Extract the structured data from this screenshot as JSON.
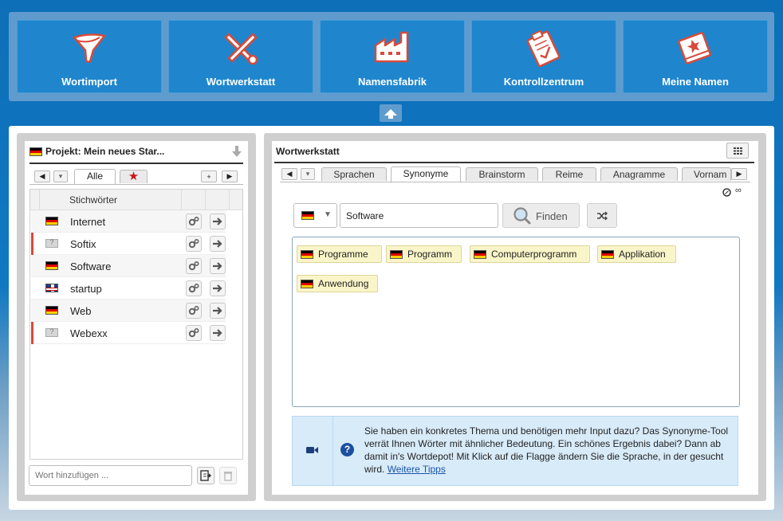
{
  "nav": {
    "tiles": [
      {
        "label": "Wortimport",
        "icon": "funnel-icon"
      },
      {
        "label": "Wortwerkstatt",
        "icon": "tools-icon"
      },
      {
        "label": "Namensfabrik",
        "icon": "factory-icon"
      },
      {
        "label": "Kontrollzentrum",
        "icon": "clipboard-check-icon"
      },
      {
        "label": "Meine Namen",
        "icon": "star-book-icon"
      }
    ]
  },
  "project": {
    "title": "Projekt: Mein neues Star...",
    "filter_tabs": {
      "all_label": "Alle",
      "favorites_icon": "star-icon"
    },
    "column_header": "Stichwörter",
    "keywords": [
      {
        "word": "Internet",
        "flag": "de",
        "marked": false
      },
      {
        "word": "Softix",
        "flag": "unknown",
        "marked": true
      },
      {
        "word": "Software",
        "flag": "de",
        "marked": false
      },
      {
        "word": "startup",
        "flag": "uk",
        "marked": false
      },
      {
        "word": "Web",
        "flag": "de",
        "marked": false
      },
      {
        "word": "Webexx",
        "flag": "unknown",
        "marked": true
      }
    ],
    "add_placeholder": "Wort hinzufügen ..."
  },
  "workshop": {
    "title": "Wortwerkstatt",
    "tabs": [
      "Sprachen",
      "Synonyme",
      "Brainstorm",
      "Reime",
      "Anagramme",
      "Vornam"
    ],
    "active_tab": "Synonyme",
    "limit_symbol": "∞",
    "search_value": "Software",
    "find_label": "Finden",
    "results": [
      "Programme",
      "Programm",
      "Computerprogramm",
      "Applikation",
      "Anwendung"
    ],
    "info_text": "Sie haben ein konkretes Thema und benötigen mehr Input dazu? Das Synonyme-Tool verrät Ihnen Wörter mit ähnlicher Bedeutung. Ein schönes Ergebnis dabei? Dann ab damit in's Wortdepot! Mit Klick auf die Flagge ändern Sie die Sprache, in der gesucht wird.",
    "info_link": "Weitere Tipps"
  },
  "colors": {
    "accent": "#1f86ce",
    "marker": "#d64b3a",
    "chip_bg": "#faf5c9",
    "info_bg": "#d8ebf9"
  }
}
